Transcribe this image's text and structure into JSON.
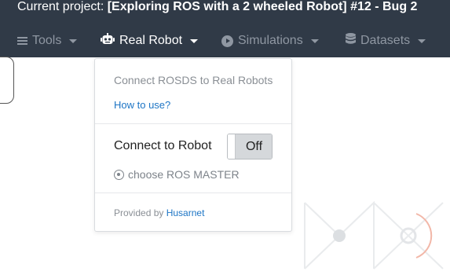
{
  "header": {
    "project_prefix": "Current project:",
    "project_name": "[Exploring ROS with a 2 wheeled Robot] #12 - Bug 2"
  },
  "nav": {
    "tools": "Tools",
    "real_robot": "Real Robot",
    "simulations": "Simulations",
    "datasets": "Datasets"
  },
  "dropdown": {
    "title": "Connect ROSDS to Real Robots",
    "how_to_link": "How to use?",
    "connect_label": "Connect to Robot",
    "toggle_state": "Off",
    "ros_master": "choose ROS MASTER",
    "provided_by": "Provided by",
    "provider": "Husarnet"
  },
  "colors": {
    "topbar": "#303a47",
    "link": "#1d75c5",
    "accent_decor": "#f2b7a8"
  }
}
